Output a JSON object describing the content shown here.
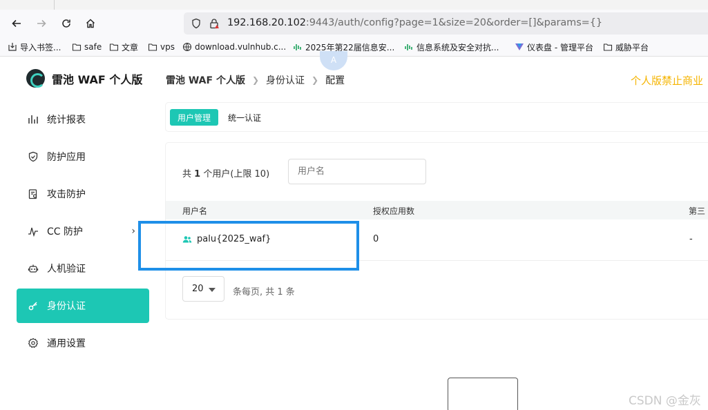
{
  "browser": {
    "url_host": "192.168.20.102",
    "url_rest": ":9443/auth/config?page=1&size=20&order=[]&params={}",
    "nav_icons": [
      "back-icon",
      "forward-icon",
      "reload-icon",
      "home-icon"
    ]
  },
  "bookmarks": [
    {
      "label": "导入书签...",
      "icon": "import-icon"
    },
    {
      "label": "safe",
      "icon": "folder-icon"
    },
    {
      "label": "文章",
      "icon": "folder-icon"
    },
    {
      "label": "vps",
      "icon": "folder-icon"
    },
    {
      "label": "download.vulnhub.c...",
      "icon": "globe-icon"
    },
    {
      "label": "2025年第22届信息安...",
      "icon": "site-icon"
    },
    {
      "label": "信息系统及安全对抗...",
      "icon": "site-icon"
    },
    {
      "label": "仪表盘 - 管理平台",
      "icon": "vuetify-icon"
    },
    {
      "label": "威胁平台",
      "icon": "folder-icon"
    }
  ],
  "app": {
    "brand": "雷池 WAF 个人版",
    "notice": "个人版禁止商业",
    "accent": "#1dc7b4"
  },
  "breadcrumb": [
    "雷池 WAF 个人版",
    "身份认证",
    "配置"
  ],
  "sidebar": {
    "items": [
      {
        "label": "统计报表",
        "icon": "bar-chart-icon"
      },
      {
        "label": "防护应用",
        "icon": "shield-icon"
      },
      {
        "label": "攻击防护",
        "icon": "clipboard-search-icon"
      },
      {
        "label": "CC 防护",
        "icon": "pulse-icon",
        "chevron": "›"
      },
      {
        "label": "人机验证",
        "icon": "robot-icon"
      },
      {
        "label": "身份认证",
        "icon": "key-icon",
        "active": true
      },
      {
        "label": "通用设置",
        "icon": "gear-icon"
      }
    ]
  },
  "tabs": [
    "用户管理",
    "统一认证"
  ],
  "main": {
    "count_prefix": "共 ",
    "count_value": "1",
    "count_suffix": " 个用户(上限 10)",
    "search_placeholder": "用户名",
    "columns": [
      "用户名",
      "授权应用数",
      "第三"
    ],
    "rows": [
      {
        "username": "palu{2025_waf}",
        "apps": "0",
        "third": "-"
      }
    ],
    "page_size": "20",
    "page_info": "条每页, 共 1 条"
  },
  "overlay": {
    "bubble_text": "A",
    "watermark": "CSDN @金灰"
  }
}
